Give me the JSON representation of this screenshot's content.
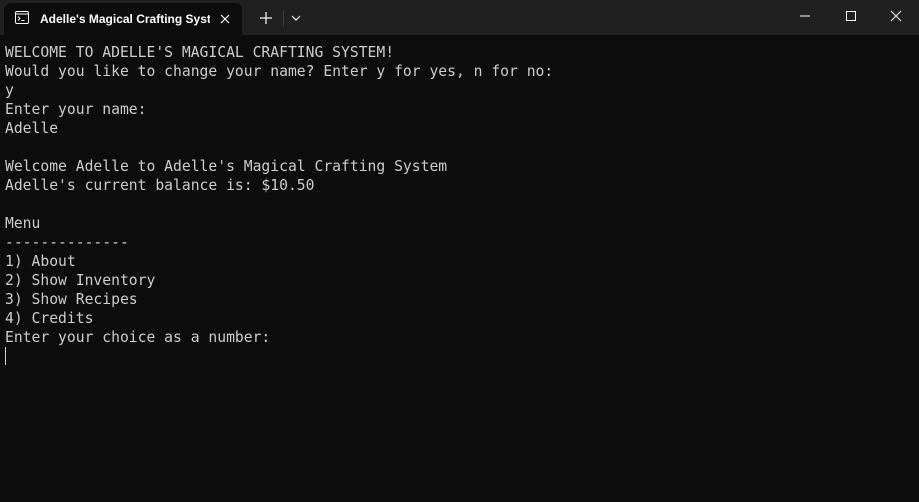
{
  "window": {
    "tab_title": "Adelle's Magical Crafting Syst"
  },
  "console": {
    "lines": [
      "WELCOME TO ADELLE'S MAGICAL CRAFTING SYSTEM!",
      "Would you like to change your name? Enter y for yes, n for no:",
      "y",
      "Enter your name:",
      "Adelle",
      "",
      "Welcome Adelle to Adelle's Magical Crafting System",
      "Adelle's current balance is: $10.50",
      "",
      "Menu",
      "--------------",
      "1) About",
      "2) Show Inventory",
      "3) Show Recipes",
      "4) Credits",
      "Enter your choice as a number:"
    ]
  },
  "colors": {
    "background": "#0c0c0c",
    "titlebar": "#202020",
    "text": "#cccccc"
  },
  "icons": {
    "tab": "terminal-icon",
    "close_tab": "close-icon",
    "new_tab": "plus-icon",
    "dropdown": "chevron-down-icon",
    "minimize": "minimize-icon",
    "maximize": "maximize-icon",
    "close_window": "close-icon"
  }
}
